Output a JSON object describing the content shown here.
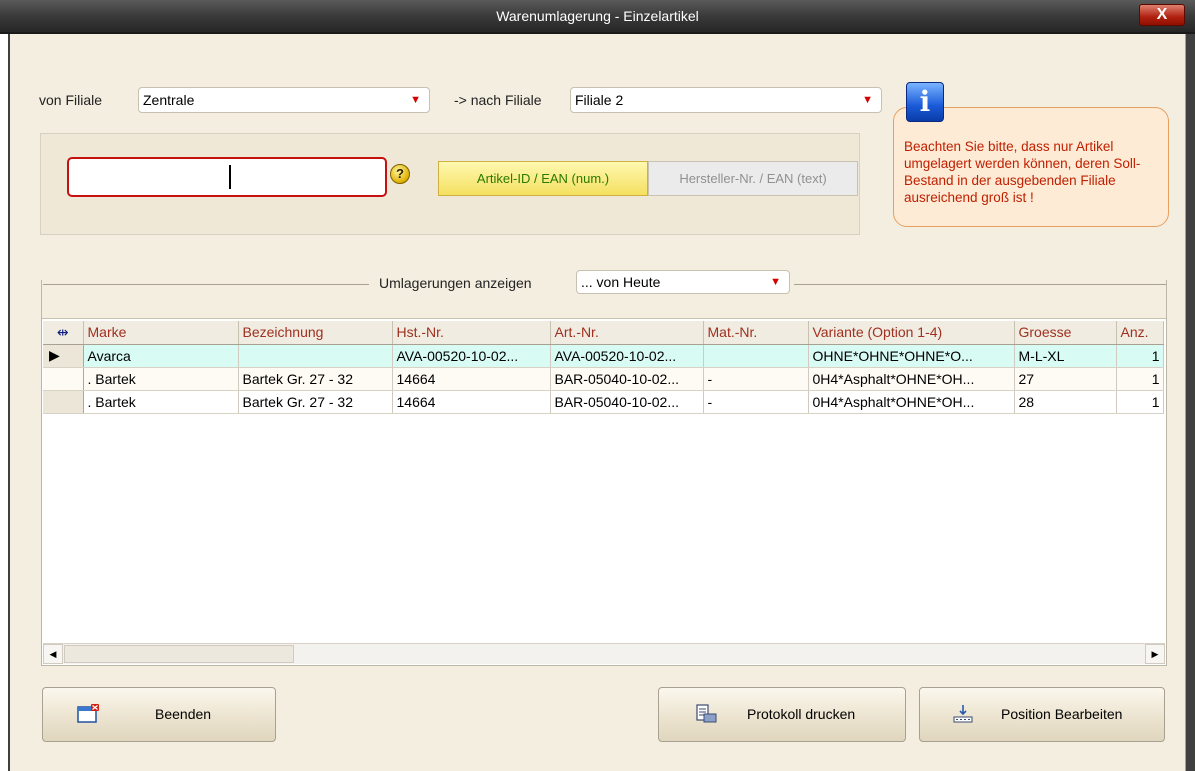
{
  "window": {
    "title": "Warenumlagerung - Einzelartikel",
    "close_glyph": "X"
  },
  "from_branch": {
    "label": "von Filiale",
    "value": "Zentrale"
  },
  "to_branch": {
    "label": "-> nach Filiale",
    "value": "Filiale 2"
  },
  "search": {
    "value": "",
    "help_glyph": "?",
    "mode_active": "Artikel-ID / EAN (num.)",
    "mode_inactive": "Hersteller-Nr. / EAN (text)"
  },
  "info": {
    "icon_glyph": "i",
    "message": "Beachten Sie bitte, dass nur Artikel umgelagert werden können, deren Soll-Bestand in der ausgebenden Filiale ausreichend groß ist !"
  },
  "filter": {
    "label": "Umlagerungen anzeigen",
    "value": "... von Heute"
  },
  "grid": {
    "resize_glyph": "⇹",
    "columns": [
      "Marke",
      "Bezeichnung",
      "Hst.-Nr.",
      "Art.-Nr.",
      "Mat.-Nr.",
      "Variante (Option 1-4)",
      "Groesse",
      "Anz."
    ],
    "rows": [
      {
        "indicator": "▶",
        "marke": "Avarca",
        "bezeichnung": "",
        "hst": "AVA-00520-10-02...",
        "art": "AVA-00520-10-02...",
        "mat": "",
        "variante": "OHNE*OHNE*OHNE*O...",
        "groesse": "M-L-XL",
        "anz": "1"
      },
      {
        "indicator": "",
        "marke": ". Bartek",
        "bezeichnung": "Bartek Gr. 27 - 32",
        "hst": "14664",
        "art": "BAR-05040-10-02...",
        "mat": "-",
        "variante": "0H4*Asphalt*OHNE*OH...",
        "groesse": "27",
        "anz": "1"
      },
      {
        "indicator": "",
        "marke": ". Bartek",
        "bezeichnung": "Bartek Gr. 27 - 32",
        "hst": "14664",
        "art": "BAR-05040-10-02...",
        "mat": "-",
        "variante": "0H4*Asphalt*OHNE*OH...",
        "groesse": "28",
        "anz": "1"
      }
    ]
  },
  "buttons": {
    "close": "Beenden",
    "print": "Protokoll drucken",
    "edit": "Position Bearbeiten"
  },
  "colors": {
    "accent_red": "#c81010",
    "header_text": "#a03020",
    "selected_row": "#d8fbf4",
    "info_text": "#c02000"
  }
}
